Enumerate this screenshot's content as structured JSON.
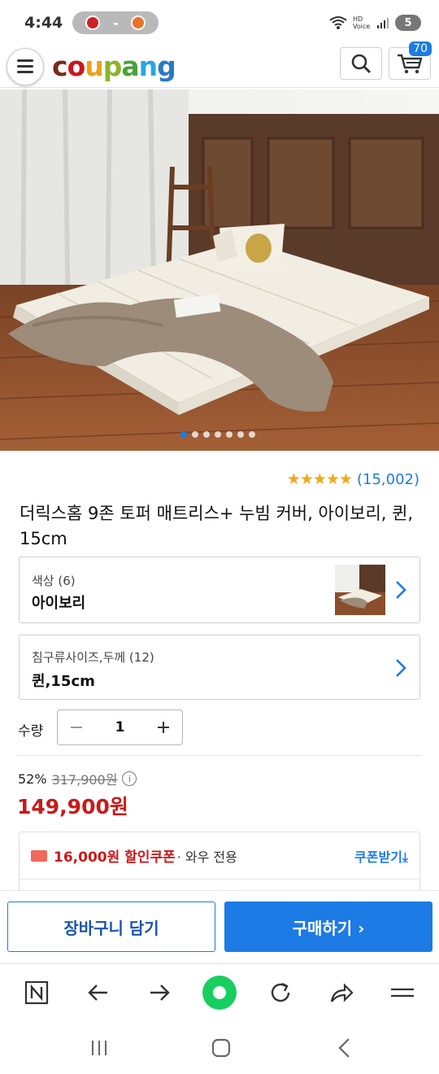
{
  "status_bar": {
    "time": "4:44",
    "pill_dash": "-",
    "battery": "5",
    "network_label": "HD Voice"
  },
  "header": {
    "logo_letters": [
      "c",
      "o",
      "u",
      "p",
      "a",
      "n",
      "g"
    ],
    "cart_count": "70"
  },
  "product": {
    "rating_stars": "★★★★★",
    "review_count": "(15,002)",
    "title": "더릭스홈 9존 토퍼 매트리스+ 누빔 커버, 아이보리, 퀸, 15cm",
    "options": [
      {
        "label": "색상 (6)",
        "value": "아이보리"
      },
      {
        "label": "침구류사이즈,두께 (12)",
        "value": "퀸,15cm"
      }
    ],
    "quantity_label": "수량",
    "quantity": "1",
    "discount_rate": "52%",
    "original_price": "317,900원",
    "sale_price": "149,900원",
    "coupon": {
      "amount": "16,000원 할인쿠폰",
      "suffix": "· 와우 전용",
      "get_label": "쿠폰받기⤓"
    }
  },
  "cta": {
    "add_to_cart": "장바구니 담기",
    "buy_now": "구매하기 ›"
  },
  "carousel": {
    "count": 7,
    "active": 0
  },
  "colors": {
    "accent": "#1c7be4",
    "price_red": "#c81a1a",
    "star": "#f2a81a"
  }
}
